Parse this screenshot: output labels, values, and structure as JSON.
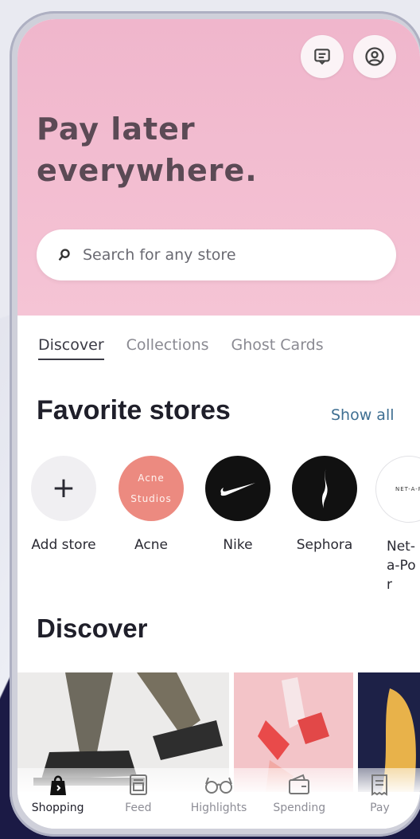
{
  "header": {
    "headline_line1": "Pay later",
    "headline_line2": "everywhere.",
    "icons": [
      "message-icon",
      "profile-icon"
    ]
  },
  "search": {
    "placeholder": "Search for any store",
    "icon": "search-icon"
  },
  "tabs": [
    {
      "label": "Discover",
      "active": true
    },
    {
      "label": "Collections",
      "active": false
    },
    {
      "label": "Ghost Cards",
      "active": false
    }
  ],
  "favorites": {
    "title": "Favorite stores",
    "show_all": "Show all",
    "stores": [
      {
        "label": "Add store",
        "logo_text": "+"
      },
      {
        "label": "Acne",
        "logo_text": "Acne Studios"
      },
      {
        "label": "Nike",
        "logo_text": ""
      },
      {
        "label": "Sephora",
        "logo_text": ""
      },
      {
        "label": "Net-a-Por",
        "logo_text": "NET-A-P"
      }
    ]
  },
  "discover": {
    "title": "Discover"
  },
  "bottom_nav": [
    {
      "label": "Shopping",
      "icon": "shopping-bag-icon",
      "active": true
    },
    {
      "label": "Feed",
      "icon": "feed-icon",
      "active": false
    },
    {
      "label": "Highlights",
      "icon": "glasses-icon",
      "active": false
    },
    {
      "label": "Spending",
      "icon": "wallet-icon",
      "active": false
    },
    {
      "label": "Pay",
      "icon": "receipt-icon",
      "active": false
    }
  ],
  "colors": {
    "hero_pink": "#f3bdd0",
    "headline": "#5b4a55",
    "link_blue": "#3f6f92",
    "acne_pink": "#ec8a80",
    "nike_black": "#111111",
    "background_navy": "#1b1a45"
  }
}
